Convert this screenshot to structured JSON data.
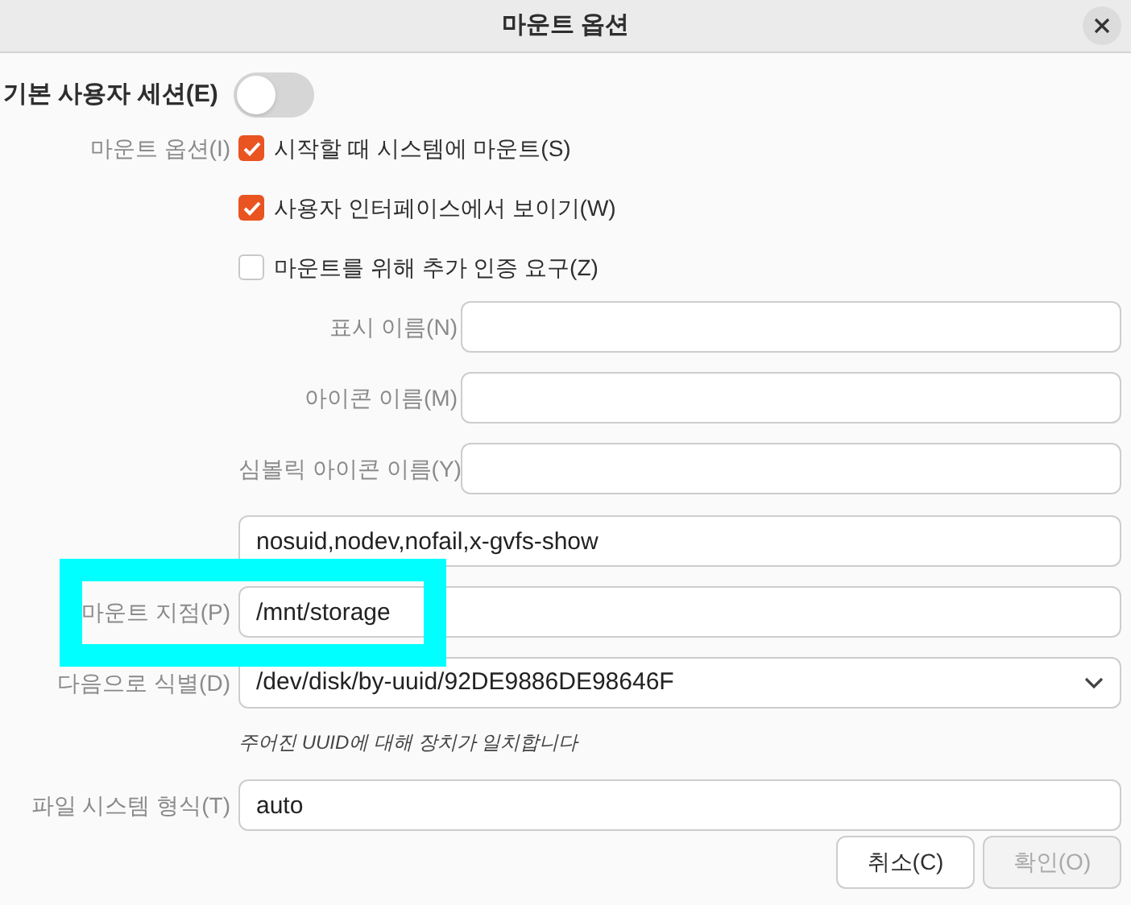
{
  "window": {
    "title": "마운트 옵션"
  },
  "user_session": {
    "label": "기본 사용자 세션(E)",
    "on": false
  },
  "mount_options": {
    "label": "마운트 옵션(I)",
    "checkboxes": [
      {
        "label": "시작할 때 시스템에 마운트(S)",
        "checked": true
      },
      {
        "label": "사용자 인터페이스에서 보이기(W)",
        "checked": true
      },
      {
        "label": "마운트를 위해 추가 인증 요구(Z)",
        "checked": false
      }
    ]
  },
  "name_fields": [
    {
      "label": "표시 이름(N)"
    },
    {
      "label": "아이콘 이름(M)"
    },
    {
      "label": "심볼릭 아이콘 이름(Y)"
    }
  ],
  "options_field": {
    "value": "nosuid,nodev,nofail,x-gvfs-show"
  },
  "mount_point": {
    "label": "마운트 지점(P)",
    "value": "/mnt/storage",
    "highlighted": true
  },
  "identify_as": {
    "label": "다음으로 식별(D)",
    "value": "/dev/disk/by-uuid/92DE9886DE98646F",
    "hint": "주어진 UUID에 대해 장치가 일치합니다"
  },
  "filesystem_type": {
    "label": "파일 시스템 형식(T)",
    "value": "auto"
  },
  "buttons": [
    {
      "label": "취소(C)",
      "disabled": false
    },
    {
      "label": "확인(O)",
      "disabled": true
    }
  ]
}
